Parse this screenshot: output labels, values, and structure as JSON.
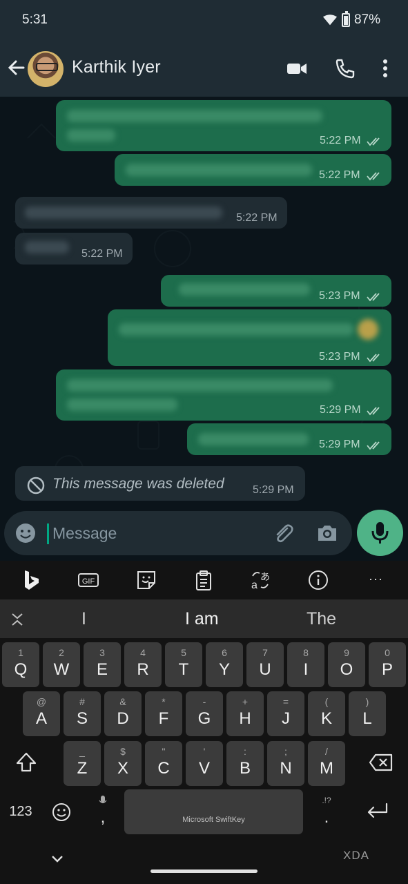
{
  "status_bar": {
    "time": "5:31",
    "battery": "87%"
  },
  "header": {
    "contact_name": "Karthik Iyer",
    "icons": [
      "back-arrow-icon",
      "video-call-icon",
      "voice-call-icon",
      "more-options-icon"
    ]
  },
  "messages": [
    {
      "direction": "out",
      "time": "5:22 PM",
      "status": "read"
    },
    {
      "direction": "out",
      "time": "5:22 PM",
      "status": "read"
    },
    {
      "direction": "in",
      "time": "5:22 PM"
    },
    {
      "direction": "in",
      "time": "5:22 PM"
    },
    {
      "direction": "out",
      "time": "5:23 PM",
      "status": "read"
    },
    {
      "direction": "out",
      "time": "5:23 PM",
      "status": "read"
    },
    {
      "direction": "out",
      "time": "5:29 PM",
      "status": "read"
    },
    {
      "direction": "out",
      "time": "5:29 PM",
      "status": "read"
    },
    {
      "direction": "in",
      "deleted": true,
      "text": "This message was deleted",
      "time": "5:29 PM"
    }
  ],
  "composer": {
    "placeholder": "Message"
  },
  "keyboard": {
    "toolbar": [
      "bing-icon",
      "gif-icon",
      "sticker-icon",
      "clipboard-icon",
      "translate-icon",
      "info-icon",
      "more-icon"
    ],
    "suggestions": [
      "I",
      "I am",
      "The"
    ],
    "row1": [
      [
        "1",
        "Q"
      ],
      [
        "2",
        "W"
      ],
      [
        "3",
        "E"
      ],
      [
        "4",
        "R"
      ],
      [
        "5",
        "T"
      ],
      [
        "6",
        "Y"
      ],
      [
        "7",
        "U"
      ],
      [
        "8",
        "I"
      ],
      [
        "9",
        "O"
      ],
      [
        "0",
        "P"
      ]
    ],
    "row2": [
      [
        "@",
        "A"
      ],
      [
        "#",
        "S"
      ],
      [
        "&",
        "D"
      ],
      [
        "*",
        "F"
      ],
      [
        "-",
        "G"
      ],
      [
        "+",
        "H"
      ],
      [
        "=",
        "J"
      ],
      [
        "(",
        "K"
      ],
      [
        ")",
        "L"
      ]
    ],
    "row3": [
      [
        "_",
        "Z"
      ],
      [
        "$",
        "X"
      ],
      [
        "\"",
        "C"
      ],
      [
        "'",
        "V"
      ],
      [
        ":",
        "B"
      ],
      [
        ";",
        "N"
      ],
      [
        "/",
        "M"
      ]
    ],
    "numbers_key": "123",
    "comma": ",",
    "period": ".",
    "period_alt": ".!?",
    "space_label": "Microsoft SwiftKey",
    "more_ellipsis": "···"
  },
  "watermark": "XDA",
  "colors": {
    "header_bg": "#1f2c34",
    "outgoing_bubble": "#1d6d4c",
    "incoming_bubble": "#202c33",
    "accent": "#4fb387"
  }
}
